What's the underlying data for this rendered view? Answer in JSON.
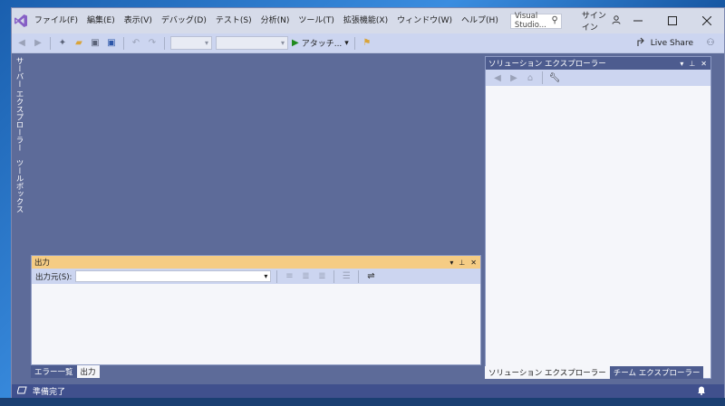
{
  "menu": {
    "items": [
      "ファイル(F)",
      "編集(E)",
      "表示(V)",
      "デバッグ(D)",
      "テスト(S)",
      "分析(N)",
      "ツール(T)",
      "拡張機能(X)",
      "ウィンドウ(W)",
      "ヘルプ(H)"
    ]
  },
  "search": {
    "value": "Visual Studio..."
  },
  "account": {
    "signin_label": "サインイン"
  },
  "toolbar": {
    "attach_label": "アタッチ...",
    "liveshare_label": "Live Share"
  },
  "side_tabs": {
    "server_explorer": "サーバー エクスプローラー",
    "toolbox": "ツールボックス"
  },
  "solution_explorer": {
    "title": "ソリューション エクスプローラー",
    "tabs": [
      "ソリューション エクスプローラー",
      "チーム エクスプローラー"
    ]
  },
  "output": {
    "title": "出力",
    "source_label": "出力元(S):",
    "tabs": [
      "エラー一覧",
      "出力"
    ]
  },
  "status": {
    "text": "準備完了"
  },
  "colors": {
    "accent": "#40508d",
    "output_title": "#f5cc84",
    "vs_purple": "#865fc5"
  }
}
